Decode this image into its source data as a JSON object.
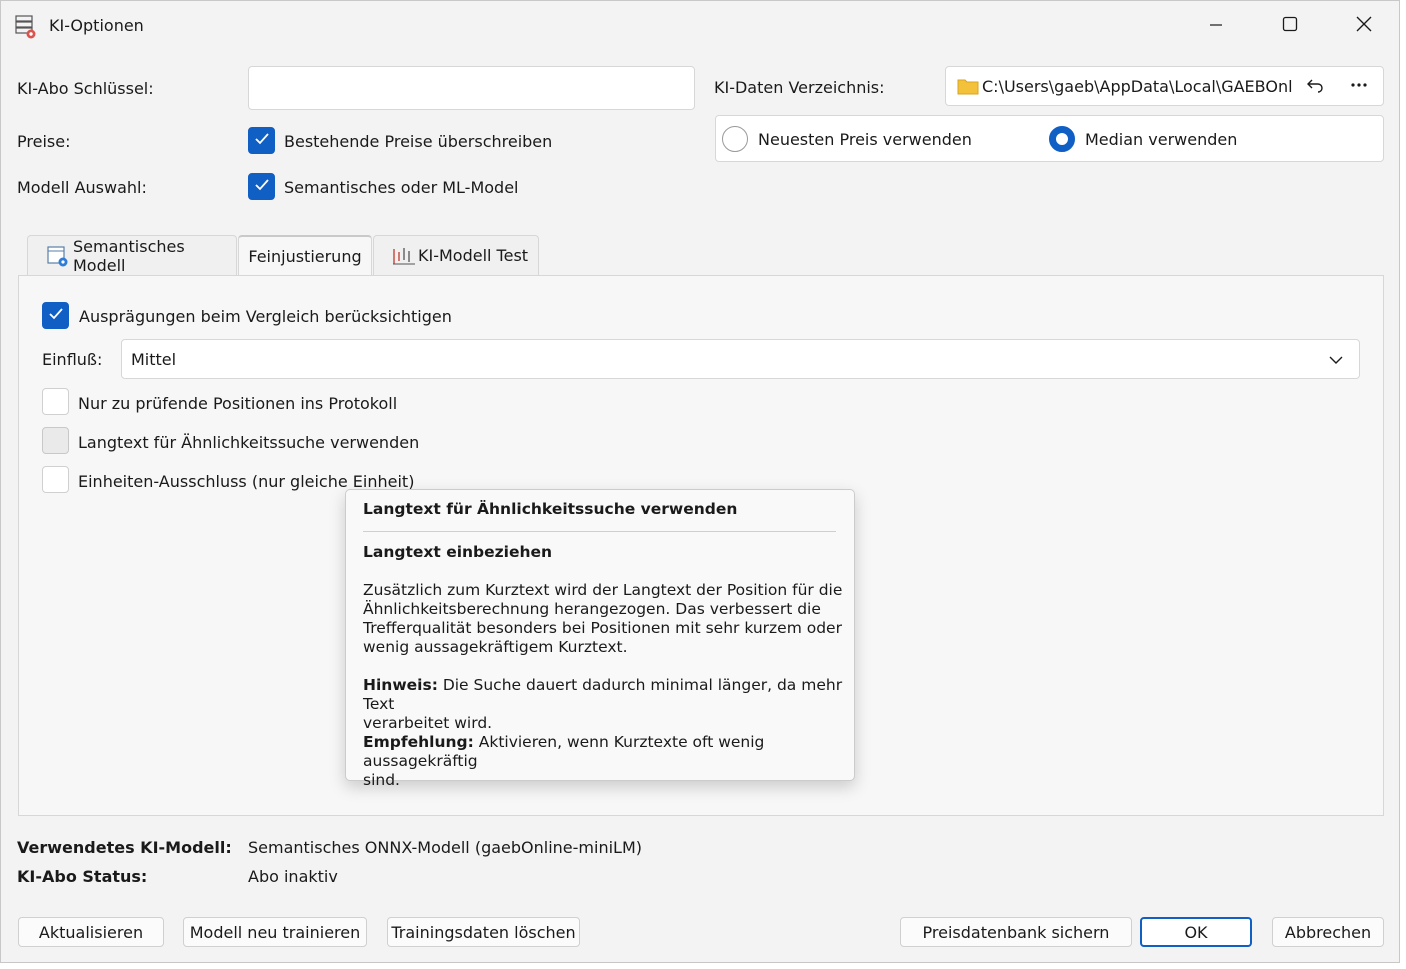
{
  "window": {
    "title": "KI-Optionen",
    "icon": "server-settings-icon",
    "controls": [
      "minimize-icon",
      "maximize-icon",
      "close-icon"
    ]
  },
  "form": {
    "abo_key_label": "KI-Abo Schlüssel:",
    "abo_key_value": "",
    "data_dir_label": "KI-Daten Verzeichnis:",
    "data_dir_value": "C:\\Users\\gaeb\\AppData\\Local\\GAEBOnline\\I",
    "prices_label": "Preise:",
    "overwrite_prices_label": "Bestehende Preise überschreiben",
    "overwrite_prices_checked": true,
    "price_mode": {
      "options": [
        "Neuesten Preis verwenden",
        "Median verwenden"
      ],
      "selected": "Median verwenden"
    },
    "model_select_label": "Modell Auswahl:",
    "semantic_model_label": "Semantisches oder ML-Model",
    "semantic_model_checked": true
  },
  "tabs": [
    {
      "label": "Semantisches Modell",
      "icon": "semantic-model-icon",
      "active": false
    },
    {
      "label": "Feinjustierung",
      "icon": "",
      "active": true
    },
    {
      "label": "KI-Modell Test",
      "icon": "chart-test-icon",
      "active": false
    }
  ],
  "fine_tuning": {
    "compare_variants_label": "Ausprägungen beim Vergleich berücksichtigen",
    "compare_variants_checked": true,
    "influence_label": "Einfluß:",
    "influence_value": "Mittel",
    "only_check_label": "Nur zu prüfende Positionen ins Protokoll",
    "only_check_checked": false,
    "longtext_label": "Langtext für Ähnlichkeitssuche verwenden",
    "longtext_checked": false,
    "units_exclusion_label": "Einheiten-Ausschluss (nur gleiche Einheit)",
    "units_exclusion_checked": false
  },
  "tooltip": {
    "title": "Langtext für Ähnlichkeitssuche verwenden",
    "subtitle": "Langtext einbeziehen",
    "body_lines": [
      "Zusätzlich zum Kurztext wird der Langtext der Position für die",
      "Ähnlichkeitsberechnung herangezogen. Das verbessert die",
      "Trefferqualität besonders bei Positionen mit sehr kurzem oder",
      "wenig aussagekräftigem Kurztext."
    ],
    "hint_label": "Hinweis:",
    "hint_lines": [
      " Die Suche dauert dadurch minimal länger, da mehr Text",
      "verarbeitet wird."
    ],
    "recommendation_label": "Empfehlung:",
    "recommendation_lines": [
      " Aktivieren, wenn Kurztexte oft wenig aussagekräftig",
      "sind."
    ]
  },
  "status": {
    "model_label": "Verwendetes KI-Modell:",
    "model_value": "Semantisches ONNX-Modell (gaebOnline-miniLM)",
    "abo_status_label": "KI-Abo Status:",
    "abo_status_value": "Abo inaktiv"
  },
  "buttons": {
    "refresh": "Aktualisieren",
    "retrain": "Modell neu trainieren",
    "delete_training": "Trainingsdaten löschen",
    "backup_db": "Preisdatenbank sichern",
    "ok": "OK",
    "cancel": "Abbrechen"
  },
  "colors": {
    "accent": "#0f5fc4",
    "window_bg": "#f3f3f3",
    "folder": "#f3c13a"
  }
}
